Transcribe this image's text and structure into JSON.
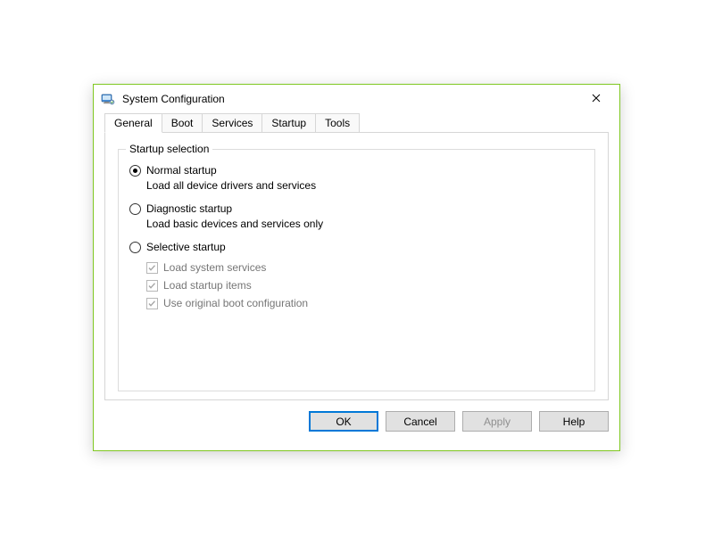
{
  "window": {
    "title": "System Configuration"
  },
  "tabs": [
    {
      "label": "General"
    },
    {
      "label": "Boot"
    },
    {
      "label": "Services"
    },
    {
      "label": "Startup"
    },
    {
      "label": "Tools"
    }
  ],
  "group": {
    "legend": "Startup selection",
    "options": [
      {
        "label": "Normal startup",
        "desc": "Load all device drivers and services"
      },
      {
        "label": "Diagnostic startup",
        "desc": "Load basic devices and services only"
      },
      {
        "label": "Selective startup"
      }
    ],
    "checks": [
      {
        "label": "Load system services"
      },
      {
        "label": "Load startup items"
      },
      {
        "label": "Use original boot configuration"
      }
    ]
  },
  "buttons": {
    "ok": "OK",
    "cancel": "Cancel",
    "apply": "Apply",
    "help": "Help"
  }
}
